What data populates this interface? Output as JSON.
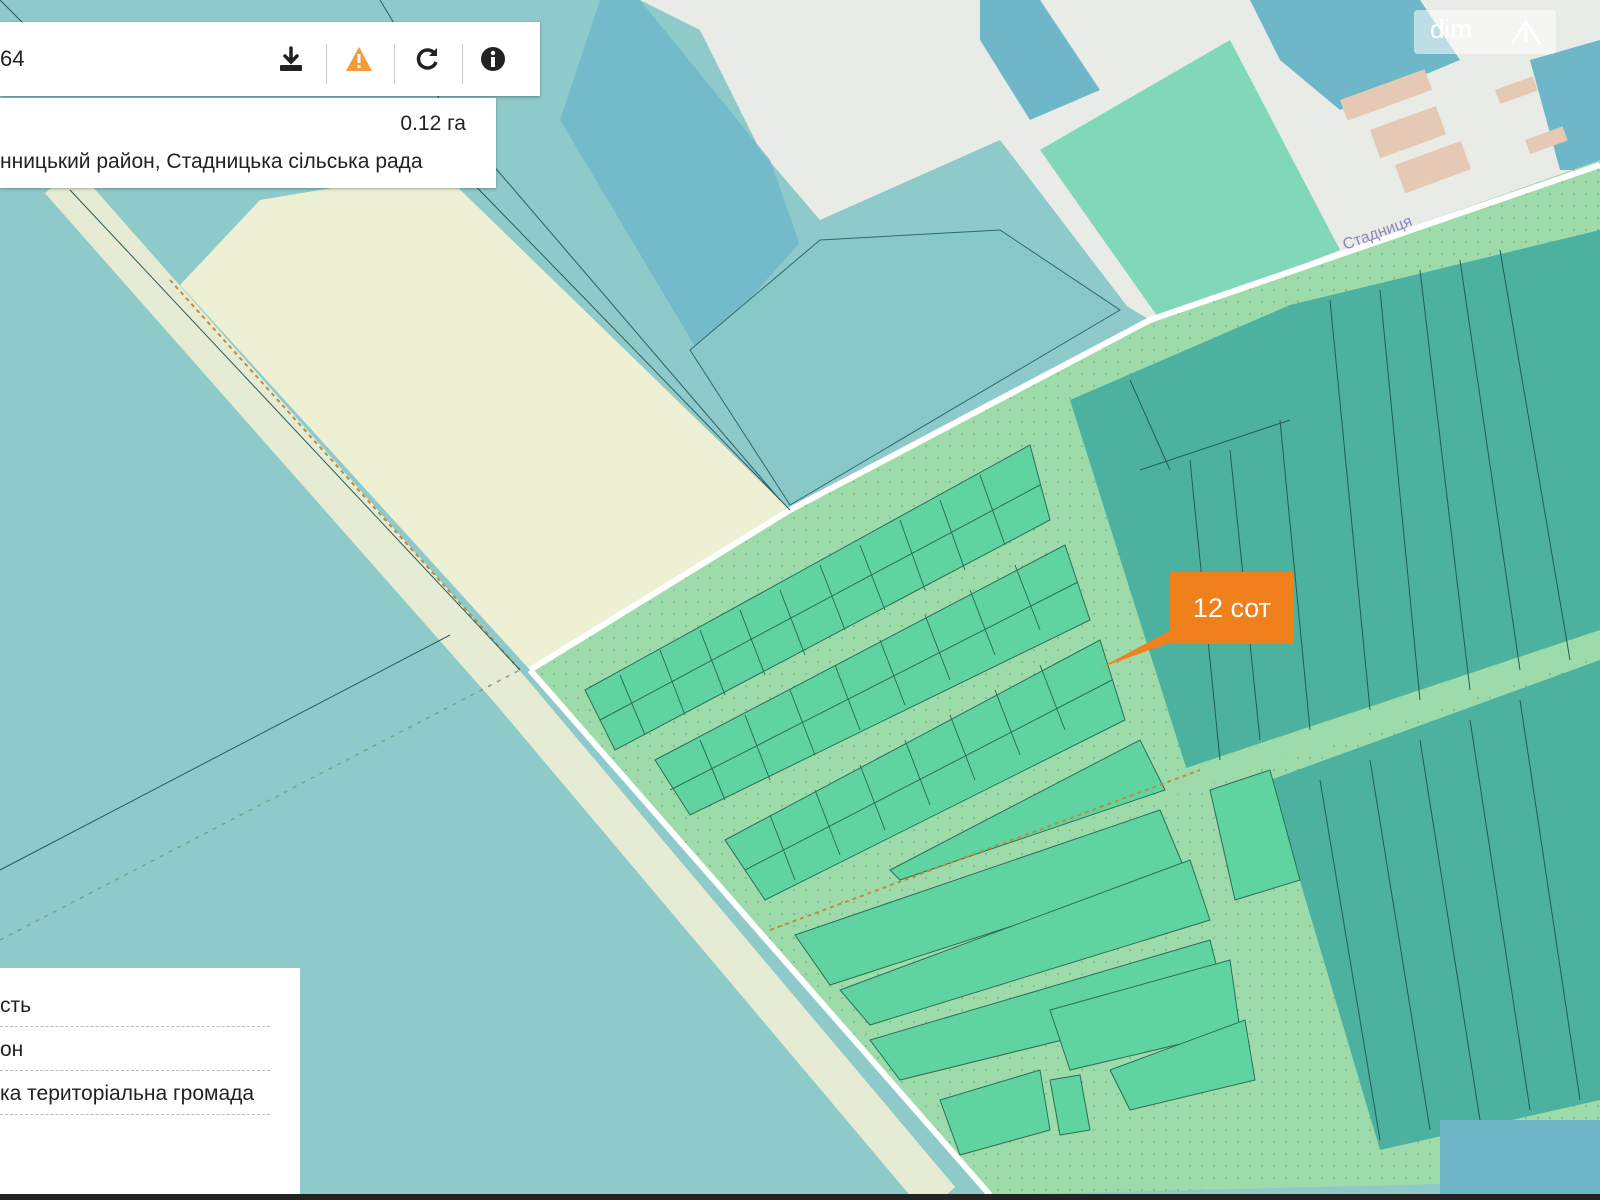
{
  "toolbar": {
    "cadastral_number_fragment": "64",
    "buttons": [
      {
        "name": "download",
        "icon": "download-icon"
      },
      {
        "name": "warning",
        "icon": "warning-icon",
        "color": "#f39a3a"
      },
      {
        "name": "refresh",
        "icon": "refresh-icon"
      },
      {
        "name": "info",
        "icon": "info-icon"
      }
    ]
  },
  "parcel_info": {
    "area": "0.12 га",
    "address_fragment": "нницький район, Стадницька сільська рада"
  },
  "legend": {
    "items": [
      "сть",
      "он",
      "ка територіальна громада"
    ]
  },
  "map": {
    "street_label": "Стадниця"
  },
  "logo": {
    "text": "dim"
  },
  "callout": {
    "text": "12 сот",
    "color": "#f0801c"
  },
  "colors": {
    "parcel_teal": "#8ecaca",
    "parcel_dark": "#4db1a0",
    "green_zone": "#9edbaa",
    "small_plot": "#5fd4a0",
    "road": "#ffffff",
    "beige_field": "#eef0d4",
    "water": "#6db7c9"
  }
}
